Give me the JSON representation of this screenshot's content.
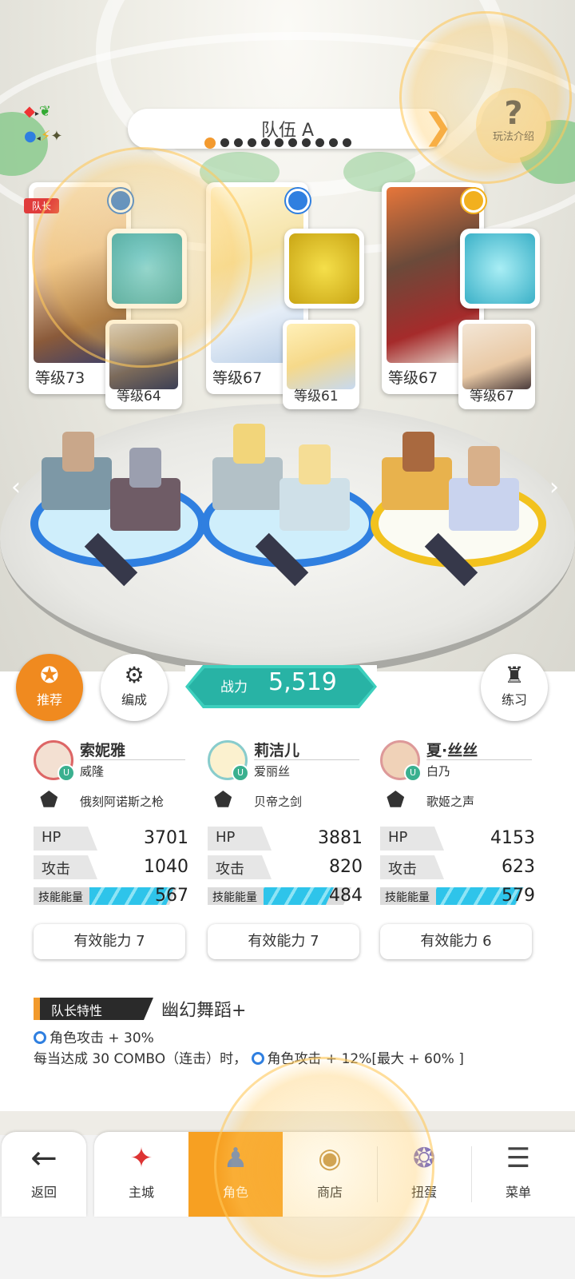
{
  "header": {
    "team_title": "队伍 A",
    "page_dots": 11,
    "active_dot": 0,
    "help_icon": "question-icon",
    "help_label": "玩法介绍",
    "element_cycle_icon": "element-cycle-icon"
  },
  "formation": [
    {
      "leader_tag": "队长",
      "main_level": "等级73",
      "main_element_color": "#2f7fe0",
      "weapon_icon": "spear-icon",
      "sub_level": "等级64"
    },
    {
      "leader_tag": "",
      "main_level": "等级67",
      "main_element_color": "#2f7fe0",
      "weapon_icon": "sword-icon",
      "sub_level": "等级61"
    },
    {
      "leader_tag": "",
      "main_level": "等级67",
      "main_element_color": "#f2b01e",
      "weapon_icon": "crystal-icon",
      "sub_level": "等级67"
    }
  ],
  "actions": {
    "recommend_label": "推荐",
    "organize_label": "编成",
    "practice_label": "练习",
    "power_label": "战力",
    "power_value": "5,519"
  },
  "characters": [
    {
      "name": "索妮雅",
      "sub_name": "威隆",
      "badge": "U",
      "weapon": "俄刻阿诺斯之枪",
      "hp_label": "HP",
      "hp": "3701",
      "atk_label": "攻击",
      "atk": "1040",
      "energy_label": "技能能量",
      "energy": "567",
      "energy_fill": 0.72,
      "effective": "有效能力 7"
    },
    {
      "name": "莉洁儿",
      "sub_name": "爱丽丝",
      "badge": "U",
      "weapon": "贝帝之剑",
      "hp_label": "HP",
      "hp": "3881",
      "atk_label": "攻击",
      "atk": "820",
      "energy_label": "技能能量",
      "energy": "484",
      "energy_fill": 0.6,
      "effective": "有效能力 7"
    },
    {
      "name": "夏·丝丝",
      "sub_name": "白乃",
      "badge": "U",
      "weapon": "歌姬之声",
      "hp_label": "HP",
      "hp": "4153",
      "atk_label": "攻击",
      "atk": "623",
      "energy_label": "技能能量",
      "energy": "579",
      "energy_fill": 0.74,
      "effective": "有效能力 6"
    }
  ],
  "leader_skill": {
    "label": "队长特性",
    "name": "幽幻舞蹈+",
    "line1": "角色攻击 + 30%",
    "line2_a": "每当达成 30 COMBO（连击）时，",
    "line2_b": "角色攻击 + 12%[最大 + 60% ]"
  },
  "nav": {
    "back": "返回",
    "items": [
      "主城",
      "角色",
      "商店",
      "扭蛋",
      "菜单"
    ],
    "active_index": 1
  },
  "colors": {
    "accent": "#f7a022",
    "power": "#28b3a5",
    "water_element": "#2f7fe0",
    "energy_bar": "#2ec4ea"
  }
}
